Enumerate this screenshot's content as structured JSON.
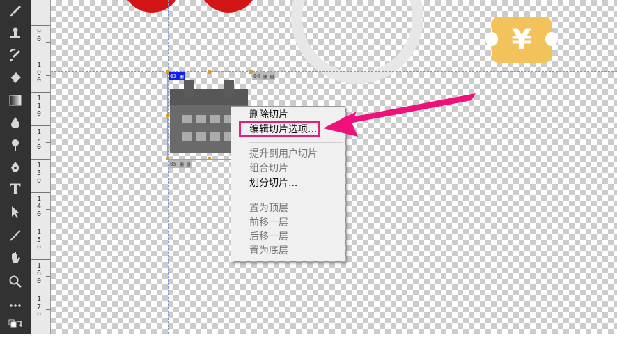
{
  "toolbar": {
    "tools": [
      "brush-icon",
      "stamp-icon",
      "history-brush-icon",
      "eraser-icon",
      "gradient-icon",
      "blur-icon",
      "dodge-icon",
      "pen-icon",
      "text-tool-icon",
      "path-selection-icon",
      "line-icon",
      "hand-icon",
      "zoom-icon",
      "more-tools-icon",
      "swap-colors-icon"
    ],
    "type_tool_glyph": "T"
  },
  "ruler": {
    "labels": [
      "9\n0",
      "1\n0\n0",
      "1\n1\n0",
      "1\n2\n0",
      "1\n3\n0",
      "1\n4\n0",
      "1\n5\n0",
      "1\n6\n0",
      "1\n7\n0"
    ]
  },
  "canvas": {
    "ticket_symbol": "¥",
    "colors": {
      "red": "#d41515",
      "ticket": "#f2c35a",
      "guide": "#7a95c9",
      "highlight": "#e4207c"
    }
  },
  "slices": {
    "active_tag": "03",
    "right_tag": "04",
    "bottom_tag": "05"
  },
  "context_menu": {
    "items": [
      {
        "label": "删除切片",
        "enabled": true
      },
      {
        "label": "编辑切片选项...",
        "enabled": true,
        "highlighted": true
      },
      {
        "label": "提升到用户切片",
        "enabled": false
      },
      {
        "label": "组合切片",
        "enabled": false
      },
      {
        "label": "划分切片...",
        "enabled": true
      },
      {
        "label": "置为顶层",
        "enabled": false
      },
      {
        "label": "前移一层",
        "enabled": false
      },
      {
        "label": "后移一层",
        "enabled": false
      },
      {
        "label": "置为底层",
        "enabled": false
      }
    ]
  }
}
